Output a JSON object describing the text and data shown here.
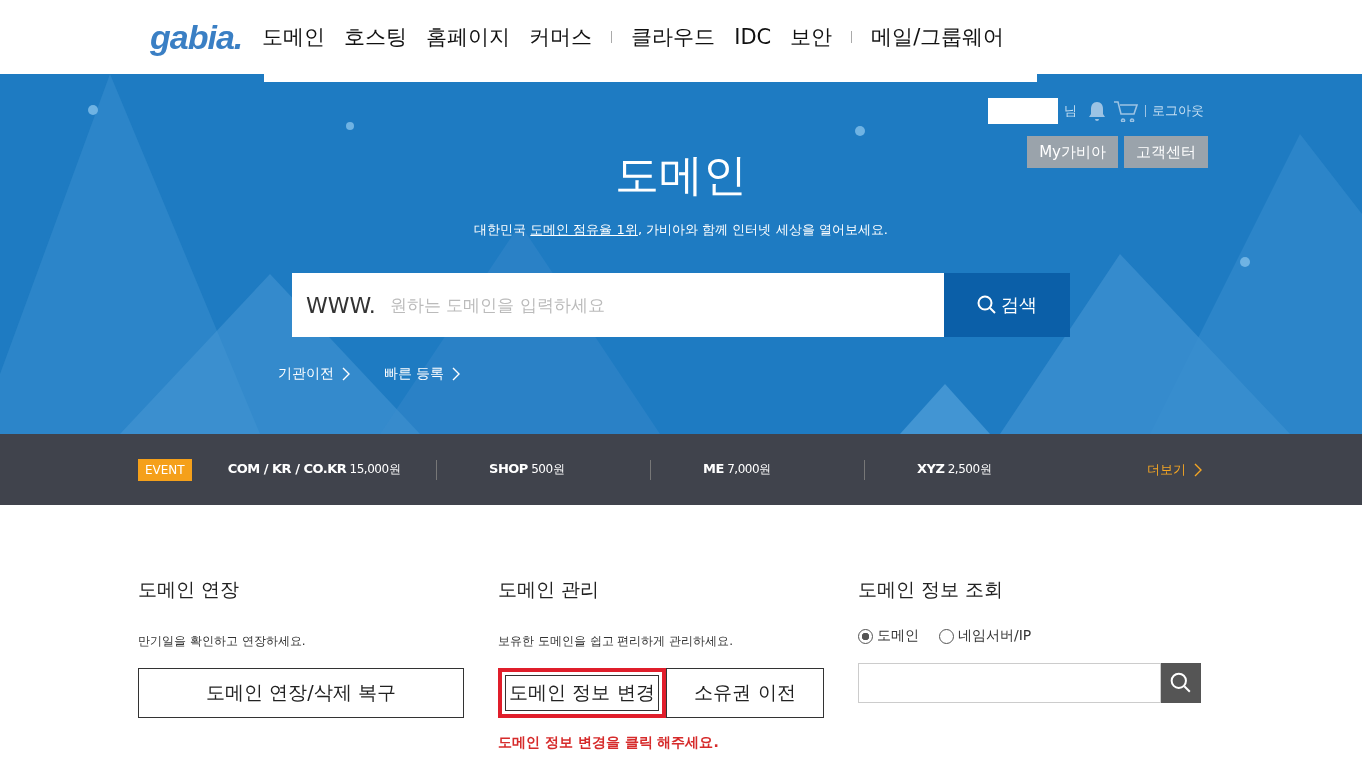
{
  "header": {
    "logo": "gabia.",
    "nav_groups": [
      [
        "도메인",
        "호스팅",
        "홈페이지",
        "커머스"
      ],
      [
        "클라우드",
        "IDC",
        "보안"
      ],
      [
        "메일/그룹웨어"
      ]
    ]
  },
  "user_bar": {
    "name_suffix": "님",
    "logout": "로그아웃",
    "buttons": [
      "My가비아",
      "고객센터"
    ]
  },
  "hero": {
    "title": "도메인",
    "subtitle_before": "대한민국 ",
    "subtitle_link": "도메인 점유율 1위",
    "subtitle_after": ", 가비아와 함께 인터넷 세상을 열어보세요.",
    "search": {
      "prefix": "WWW.",
      "placeholder": "원하는 도메인을 입력하세요",
      "button": "검색"
    },
    "links": [
      "기관이전",
      "빠른 등록"
    ]
  },
  "event_bar": {
    "badge": "EVENT",
    "items": [
      {
        "name": "COM / KR / CO.KR",
        "price": "15,000원"
      },
      {
        "name": "SHOP",
        "price": "500원"
      },
      {
        "name": "ME",
        "price": "7,000원"
      },
      {
        "name": "XYZ",
        "price": "2,500원"
      }
    ],
    "more": "더보기"
  },
  "sections": [
    {
      "kind": "buttons",
      "title": "도메인 연장",
      "desc": "만기일을 확인하고 연장하세요.",
      "buttons": [
        {
          "label": "도메인 연장/삭제 복구",
          "highlighted": false
        }
      ]
    },
    {
      "kind": "buttons",
      "title": "도메인 관리",
      "desc": "보유한 도메인을 쉽고 편리하게 관리하세요.",
      "buttons": [
        {
          "label": "도메인 정보 변경",
          "highlighted": true
        },
        {
          "label": "소유권 이전",
          "highlighted": false
        }
      ],
      "note": "도메인 정보 변경을 클릭 해주세요."
    },
    {
      "kind": "lookup",
      "title": "도메인 정보 조회",
      "options": [
        {
          "label": "도메인",
          "selected": true
        },
        {
          "label": "네임서버/IP",
          "selected": false
        }
      ]
    }
  ]
}
